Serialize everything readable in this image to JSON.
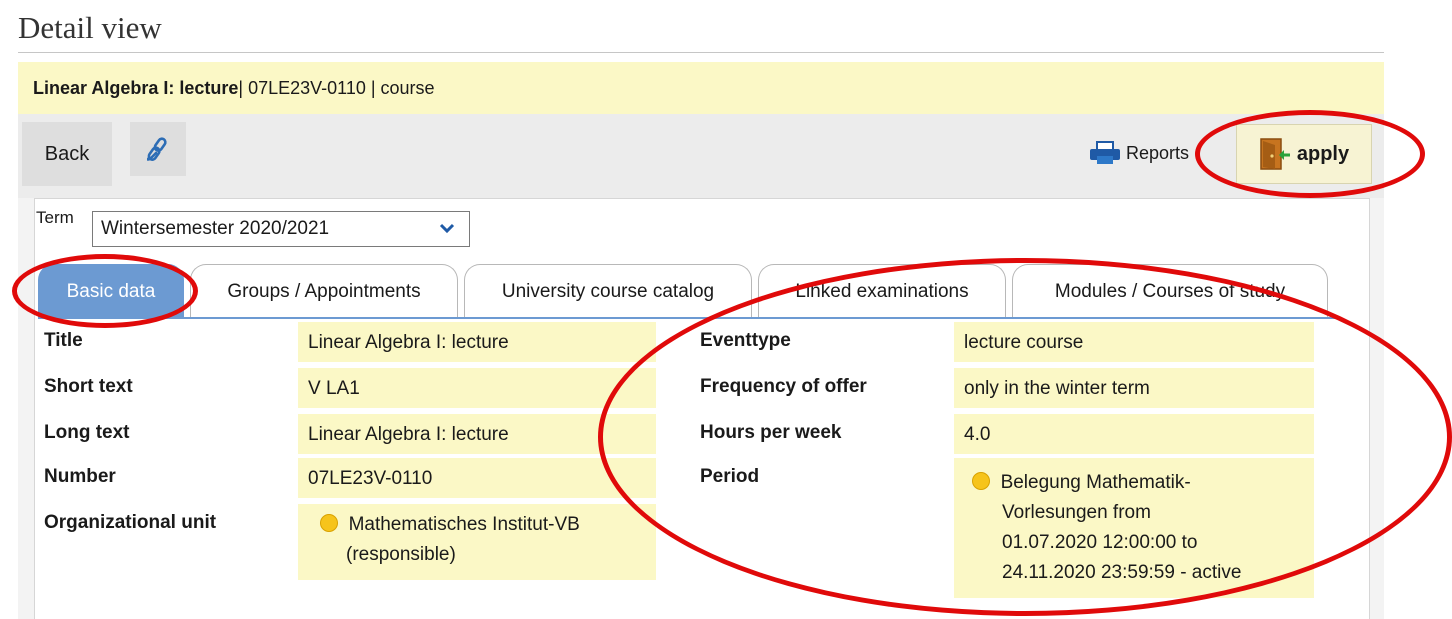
{
  "page": {
    "title": "Detail view"
  },
  "course_header": {
    "bold_title": "Linear Algebra I: lecture",
    "rest": " | 07LE23V-0110 | course"
  },
  "toolbar": {
    "back_label": "Back",
    "link_icon": "link-icon",
    "reports_label": "Reports",
    "reports_icon": "printer-icon",
    "apply_label": "apply",
    "apply_icon": "door-enter-icon"
  },
  "term": {
    "label": "Term",
    "selected": "Wintersemester 2020/2021"
  },
  "tabs": [
    {
      "label": "Basic data",
      "active": true
    },
    {
      "label": "Groups / Appointments",
      "active": false
    },
    {
      "label": "University course catalog",
      "active": false
    },
    {
      "label": "Linked examinations",
      "active": false
    },
    {
      "label": "Modules / Courses of study",
      "active": false
    }
  ],
  "basic_data": {
    "left": [
      {
        "label": "Title",
        "value": "Linear Algebra I: lecture"
      },
      {
        "label": "Short text",
        "value": "V LA1"
      },
      {
        "label": "Long text",
        "value": "Linear Algebra I: lecture"
      },
      {
        "label": "Number",
        "value": "07LE23V-0110"
      },
      {
        "label": "Organizational unit",
        "value_line1": "Mathematisches Institut-VB",
        "value_line2": "(responsible)"
      }
    ],
    "right": [
      {
        "label": "Eventtype",
        "value": "lecture course"
      },
      {
        "label": "Frequency of offer",
        "value": "only in the winter term"
      },
      {
        "label": "Hours per week",
        "value": "4.0"
      },
      {
        "label": "Period",
        "value_lines": [
          "Belegung Mathematik-",
          "Vorlesungen from",
          "01.07.2020 12:00:00 to",
          "24.11.2020 23:59:59 - active"
        ]
      }
    ]
  },
  "colors": {
    "accent_blue": "#6c9ad2",
    "highlight_yellow": "#fbf8c6",
    "annotation_red": "#e00a0a",
    "status_dot": "#f6c41b"
  }
}
